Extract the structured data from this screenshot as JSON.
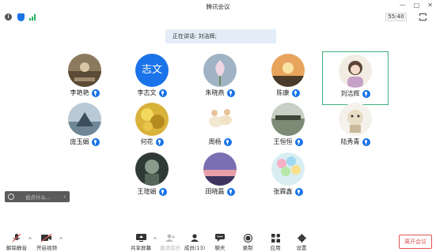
{
  "window": {
    "title": "腾讯会议",
    "controls": [
      "—",
      "□",
      "✕"
    ]
  },
  "status": {
    "timer": "55:40"
  },
  "speaking": {
    "text": "正在讲话: 刘洁辉;"
  },
  "participants": [
    {
      "name": "李艳艳"
    },
    {
      "name": "李志文",
      "avatar_text": "志文"
    },
    {
      "name": "朱晓燕"
    },
    {
      "name": "陈康"
    },
    {
      "name": "刘洁辉"
    },
    {
      "name": "庞玉娟"
    },
    {
      "name": "何花"
    },
    {
      "name": "周杨"
    },
    {
      "name": "王恒恒"
    },
    {
      "name": "陆秀青"
    },
    {
      "name": "王瑄娟"
    },
    {
      "name": "田晓磊"
    },
    {
      "name": "张霖鑫"
    }
  ],
  "chat": {
    "placeholder": "说点什么...",
    "arrow": "‹"
  },
  "toolbar": {
    "unmute": "解除静音",
    "video": "开启视频",
    "share": "共享屏幕",
    "invite": "邀请成员",
    "members": "成员(13)",
    "chat": "聊天",
    "record": "录制",
    "apps": "应用",
    "settings": "设置",
    "leave": "离开会议",
    "caret": "^"
  },
  "colors": {
    "accent": "#1a73e8",
    "active_border": "#3fae7a",
    "leave": "#e05555"
  }
}
